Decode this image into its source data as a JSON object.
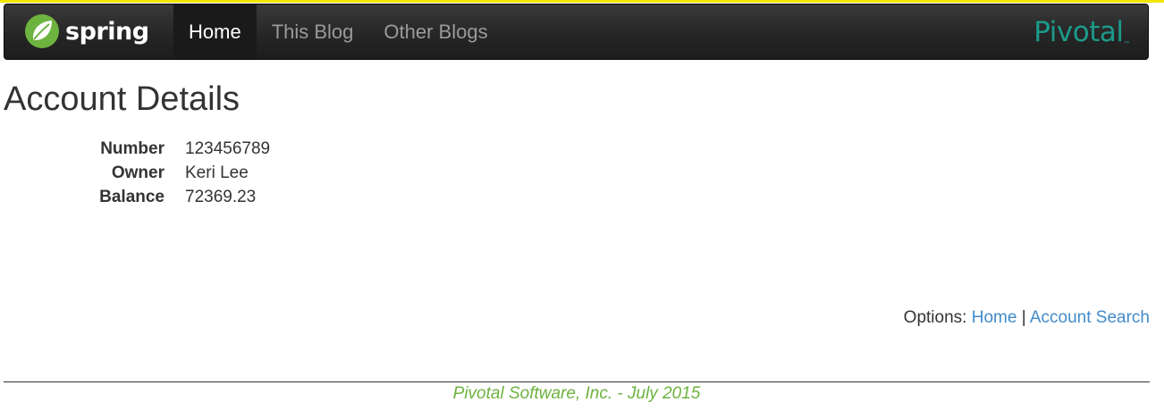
{
  "navbar": {
    "brand": "spring",
    "items": [
      {
        "label": "Home",
        "active": true
      },
      {
        "label": "This Blog",
        "active": false
      },
      {
        "label": "Other Blogs",
        "active": false
      }
    ],
    "partner_logo": "Pivotal",
    "partner_logo_mark": "™"
  },
  "page": {
    "title": "Account Details"
  },
  "account": {
    "number_label": "Number",
    "number": "123456789",
    "owner_label": "Owner",
    "owner": "Keri Lee",
    "balance_label": "Balance",
    "balance": "72369.23"
  },
  "options": {
    "label": "Options:",
    "home_link": "Home",
    "separator": "|",
    "account_search_link": "Account Search"
  },
  "footer": {
    "text": "Pivotal Software, Inc. - July 2015"
  },
  "colors": {
    "accent_strip": "#f2e600",
    "navbar_bg": "#262626",
    "link": "#428bca",
    "footer_text": "#6db33f",
    "pivotal_teal": "#1d9a8a",
    "spring_green": "#6db33f"
  },
  "icons": {
    "brand_icon": "spring-leaf-icon"
  }
}
